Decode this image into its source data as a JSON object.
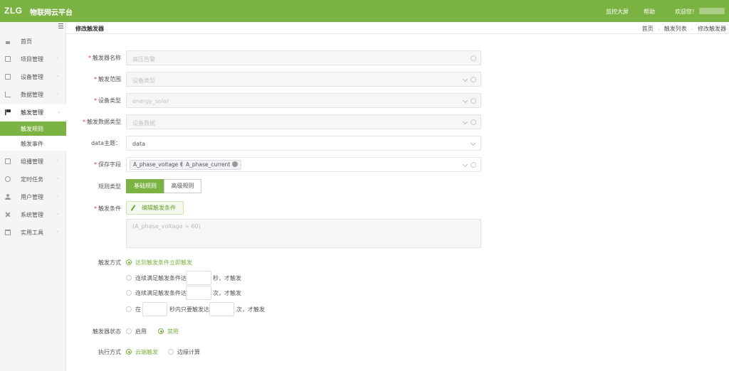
{
  "brand": {
    "logo": "ZLG",
    "title": "物联网云平台",
    "accent": "#7bb342"
  },
  "top_nav": {
    "monitor": "监控大屏",
    "help": "帮助",
    "welcome": "欢迎您！"
  },
  "sidebar": {
    "items": [
      {
        "label": "首页",
        "icon": "home-icon"
      },
      {
        "label": "项目管理",
        "icon": "project-icon"
      },
      {
        "label": "设备管理",
        "icon": "device-icon"
      },
      {
        "label": "数据管理",
        "icon": "chart-icon"
      },
      {
        "label": "触发管理",
        "icon": "flag-icon"
      },
      {
        "label": "组播管理",
        "icon": "layers-icon"
      },
      {
        "label": "定时任务",
        "icon": "timer-icon"
      },
      {
        "label": "用户管理",
        "icon": "user-icon"
      },
      {
        "label": "系统管理",
        "icon": "tools-icon"
      },
      {
        "label": "实用工具",
        "icon": "toolbox-icon"
      }
    ],
    "sub_items": [
      {
        "label": "触发规则"
      },
      {
        "label": "触发事件"
      }
    ]
  },
  "header": {
    "title": "修改触发器",
    "breadcrumb": [
      "首页",
      "触发列表",
      "修改触发器"
    ]
  },
  "form": {
    "name": {
      "label": "触发器名称",
      "placeholder": "高压告警"
    },
    "scope": {
      "label": "触发范围",
      "value": "设备类型"
    },
    "device_type": {
      "label": "设备类型",
      "value": "energy_solar"
    },
    "data_type": {
      "label": "触发数据类型",
      "value": "设备数据"
    },
    "data_topic": {
      "label": "data主题：",
      "value": "data"
    },
    "save_fields": {
      "label": "保存字段",
      "tags": [
        "A_phase_voltage",
        "A_phase_current"
      ]
    },
    "rule_type": {
      "label": "规则类型",
      "options": [
        "基础规则",
        "高级规则"
      ]
    },
    "condition": {
      "label": "触发条件",
      "button": "编辑触发条件",
      "expression": "(A_phase_voltage > 60)"
    },
    "trigger_mode": {
      "label": "触发方式",
      "opt1": "达到触发条件立即触发",
      "opt2_pre": "连续满足触发条件达",
      "opt2_post": "秒，才触发",
      "opt3_pre": "连续满足触发条件达",
      "opt3_post": "次，才触发",
      "opt4_pre": "在",
      "opt4_mid": "秒内只要触发达",
      "opt4_post": "次，才触发"
    },
    "status": {
      "label": "触发器状态",
      "enable": "启用",
      "disable": "禁用"
    },
    "exec_mode": {
      "label": "执行方式",
      "cloud": "云端触发",
      "edge": "边缘计算"
    }
  }
}
